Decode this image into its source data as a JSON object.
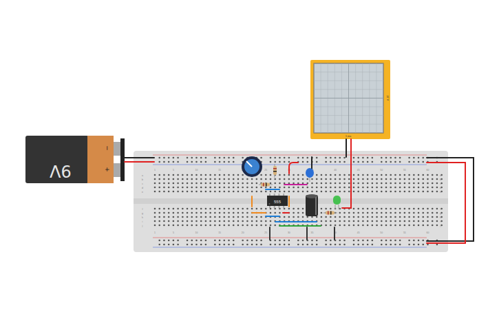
{
  "battery": {
    "label": "9V",
    "terminals": [
      "−",
      "+"
    ]
  },
  "chip": {
    "label": "555"
  },
  "oscilloscope": {
    "time_label": "1 ms",
    "volt_label": "10 V"
  },
  "breadboard": {
    "column_numbers": [
      "1",
      "5",
      "10",
      "15",
      "20",
      "25",
      "30",
      "35",
      "40",
      "45",
      "50",
      "55",
      "60"
    ],
    "row_letters": [
      "a",
      "b",
      "c",
      "d",
      "e",
      "f",
      "g",
      "h",
      "i",
      "j"
    ]
  },
  "led": {
    "on": false,
    "color": "#2ebd3a"
  },
  "wires": [
    {
      "color": "#222222"
    },
    {
      "color": "#e02020"
    },
    {
      "color": "#222222"
    },
    {
      "color": "#e02020"
    },
    {
      "color": "#e02020"
    },
    {
      "color": "#222222"
    },
    {
      "color": "#e02020"
    },
    {
      "color": "#c8209a"
    },
    {
      "color": "#1e7fd8"
    },
    {
      "color": "#f08a1e"
    },
    {
      "color": "#f08a1e"
    },
    {
      "color": "#1e7fd8"
    },
    {
      "color": "#e02020"
    },
    {
      "color": "#f08a1e"
    },
    {
      "color": "#1e7fd8"
    },
    {
      "color": "#2ea83a"
    },
    {
      "color": "#333333"
    },
    {
      "color": "#333333"
    },
    {
      "color": "#333333"
    },
    {
      "color": "#222222"
    }
  ]
}
